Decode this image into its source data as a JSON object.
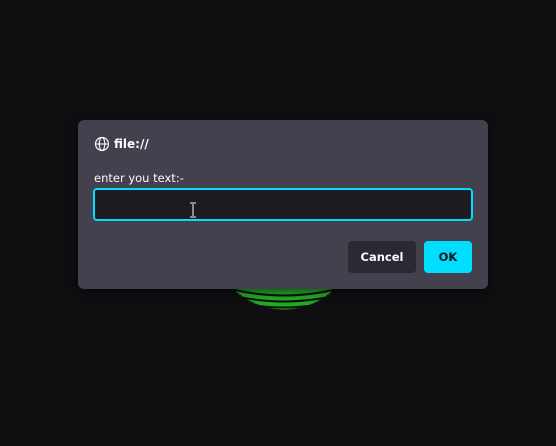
{
  "colors": {
    "page_background": "#0f0e11",
    "dialog_background": "#42414d",
    "accent": "#00ddff",
    "input_background": "#1c1b22",
    "cancel_background": "#2b2a33",
    "background_graphic": "#22aa22"
  },
  "dialog": {
    "origin_icon": "globe-icon",
    "origin": "file://",
    "message": "enter you text:-",
    "input": {
      "value": "",
      "placeholder": ""
    },
    "cancel_label": "Cancel",
    "ok_label": "OK"
  }
}
